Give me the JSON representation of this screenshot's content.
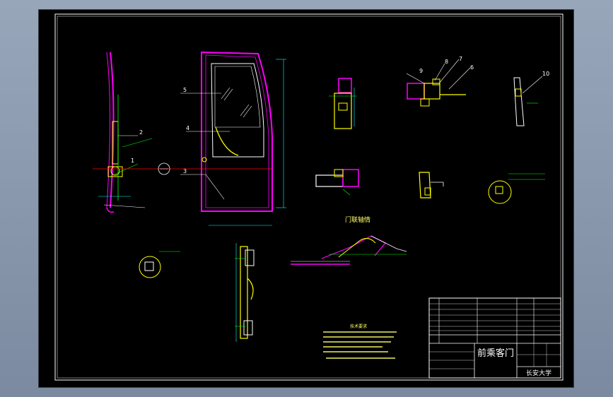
{
  "drawing": {
    "title_label": "前乘客门",
    "school_label": "长安大学",
    "section_title": "门联轴情",
    "part_numbers": [
      "2",
      "1",
      "4",
      "3",
      "5",
      "9",
      "8",
      "7",
      "6",
      "10"
    ],
    "notes_heading": "技术要求"
  },
  "colors": {
    "background": "#000000",
    "frame": "#ffffff",
    "door": "#ff00ff",
    "parts": "#ffff00",
    "leaders": "#00ff00",
    "dimensions": "#00ffff",
    "centerline": "#ff0000"
  }
}
